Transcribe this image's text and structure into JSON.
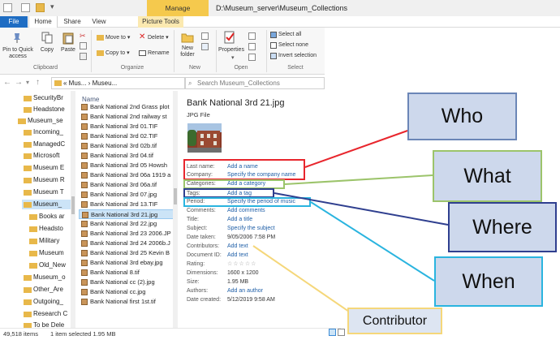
{
  "window": {
    "manage_tab": "Manage",
    "title": "D:\\Museum_server\\Museum_Collections"
  },
  "ribbon_tabs": [
    "File",
    "Home",
    "Share",
    "View",
    "Picture Tools"
  ],
  "ribbon": {
    "clipboard": {
      "pin_label": "Pin to Quick access",
      "copy_label": "Copy",
      "paste_label": "Paste",
      "group_label": "Clipboard"
    },
    "organize": {
      "move_to": "Move to",
      "copy_to": "Copy to",
      "delete": "Delete",
      "rename": "Rename",
      "group_label": "Organize"
    },
    "new": {
      "new_folder": "New folder",
      "group_label": "New"
    },
    "open": {
      "properties": "Properties",
      "group_label": "Open"
    },
    "select": {
      "select_all": "Select all",
      "select_none": "Select none",
      "invert_selection": "Invert selection",
      "group_label": "Select"
    }
  },
  "address": {
    "path": "« Mus... › Museu...",
    "search_placeholder": "Search Museum_Collections"
  },
  "nav_items": [
    "SecurityBr",
    "Headstone",
    "Museum_se",
    "Incoming_",
    "ManagedC",
    "Microsoft",
    "Museum E",
    "Museum R",
    "Museum T",
    "Museum_",
    "Books ar",
    "Headsto",
    "Military",
    "Museum",
    "Old_New",
    "Museum_o",
    "Other_Are",
    "Outgoing_",
    "Research C",
    "To be Dele"
  ],
  "file_list": {
    "column_header": "Name",
    "files": [
      "Bank National 2nd Grass plot",
      "Bank National 2nd railway st",
      "Bank National 3rd 01.TIF",
      "Bank National 3rd 02.TIF",
      "Bank National 3rd 02b.tif",
      "Bank National 3rd 04.tif",
      "Bank National 3rd 05 Howsh",
      "Bank National 3rd 06a 1919 a",
      "Bank National 3rd 06a.tif",
      "Bank National 3rd 07.jpg",
      "Bank National 3rd 13.TIF",
      "Bank National 3rd 21.jpg",
      "Bank National 3rd 22.jpg",
      "Bank National 3rd 23 2006.JP",
      "Bank National 3rd 24 2006b.J",
      "Bank National 3rd 25 Kevin B",
      "Bank National 3rd ebay.jpg",
      "Bank National 8.tif",
      "Bank National cc (2).jpg",
      "Bank National cc.jpg",
      "Bank National first 1st.tif"
    ]
  },
  "details": {
    "title": "Bank National 3rd 21.jpg",
    "type": "JPG File",
    "properties": [
      {
        "label": "Last name:",
        "value": "Add a name"
      },
      {
        "label": "Company:",
        "value": "Specify the company name"
      },
      {
        "label": "Categories:",
        "value": "Add a category"
      },
      {
        "label": "Tags:",
        "value": "Add a tag"
      },
      {
        "label": "Period:",
        "value": "Specify the period of music"
      },
      {
        "label": "Comments:",
        "value": "Add comments"
      },
      {
        "label": "Title:",
        "value": "Add a title"
      },
      {
        "label": "Subject:",
        "value": "Specify the subject"
      },
      {
        "label": "Date taken:",
        "value": "9/05/2006 7:58 PM"
      },
      {
        "label": "Contributors:",
        "value": "Add text"
      },
      {
        "label": "Document ID:",
        "value": "Add text"
      },
      {
        "label": "Rating:",
        "value": "☆☆☆☆☆"
      },
      {
        "label": "Dimensions:",
        "value": "1600 x 1200"
      },
      {
        "label": "Size:",
        "value": "1.95 MB"
      },
      {
        "label": "Authors:",
        "value": "Add an author"
      },
      {
        "label": "Date created:",
        "value": "5/12/2019 9:58 AM"
      }
    ]
  },
  "status": {
    "items_count": "49,518 items",
    "selection": "1 item selected  1.95 MB"
  },
  "callouts": {
    "who": "Who",
    "what": "What",
    "where": "Where",
    "when": "When",
    "contributor": "Contributor"
  },
  "colors": {
    "who": "#e8262d",
    "what": "#9cc46b",
    "where": "#2f3f8f",
    "when": "#2ab4df",
    "contributor": "#f5d77a",
    "callout_fill": "#cdd8ec",
    "callout_border": "#6b86b7",
    "contributor_fill": "#dde5f2"
  }
}
